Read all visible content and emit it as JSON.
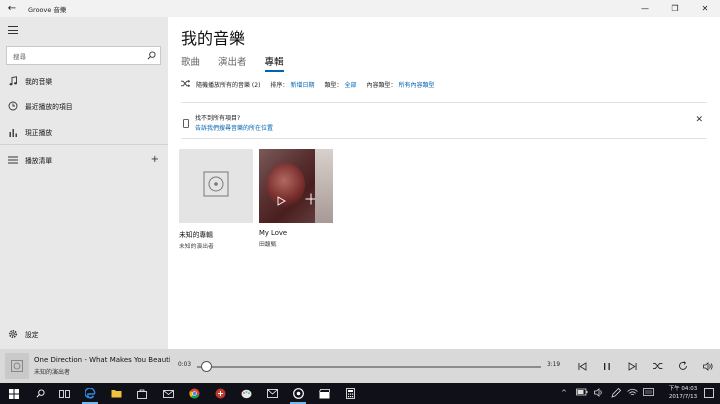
{
  "window": {
    "title": "Groove 音樂",
    "back": "←",
    "minimize": "—",
    "restore": "❐",
    "close": "✕"
  },
  "sidebar": {
    "search_placeholder": "搜尋",
    "items": [
      {
        "label": "我的音樂",
        "icon": "music-note-icon"
      },
      {
        "label": "最近播放的項目",
        "icon": "clock-icon"
      },
      {
        "label": "現正播放",
        "icon": "equalizer-icon"
      },
      {
        "label": "播放清單",
        "icon": "playlist-icon"
      }
    ],
    "add_playlist": "+",
    "settings": "設定"
  },
  "main": {
    "title": "我的音樂",
    "tabs": [
      {
        "label": "歌曲",
        "active": false
      },
      {
        "label": "演出者",
        "active": false
      },
      {
        "label": "專輯",
        "active": true
      }
    ],
    "filter": {
      "shuffle": "隨機播放所有的音樂 (2)",
      "sort_label": "排序：",
      "sort_value": "新增日期",
      "genre_label": "類型：",
      "genre_value": "全部",
      "content_label": "內容類型：",
      "content_value": "所有內容類型"
    },
    "notice": {
      "title": "找不到所有項目?",
      "link": "告訴我們搜尋音樂的所在位置",
      "close": "✕"
    },
    "albums": [
      {
        "name": "未知的專輯",
        "artist": "未知的演出者",
        "cover": "unknown"
      },
      {
        "name": "My Love",
        "artist": "田馥甄",
        "cover": "photo"
      }
    ]
  },
  "player": {
    "song": "One Direction - What Makes You Beautiful",
    "artist": "未知的演出者",
    "current_time": "0:03",
    "duration": "3:19",
    "progress": 0.015
  },
  "taskbar": {
    "time": "下午 04:03",
    "date": "2017/7/13",
    "caret": "^"
  },
  "colors": {
    "accent": "#0063b1",
    "sidebar": "#e8e8e8",
    "player": "#d9d9d9",
    "taskbar": "#101018"
  }
}
